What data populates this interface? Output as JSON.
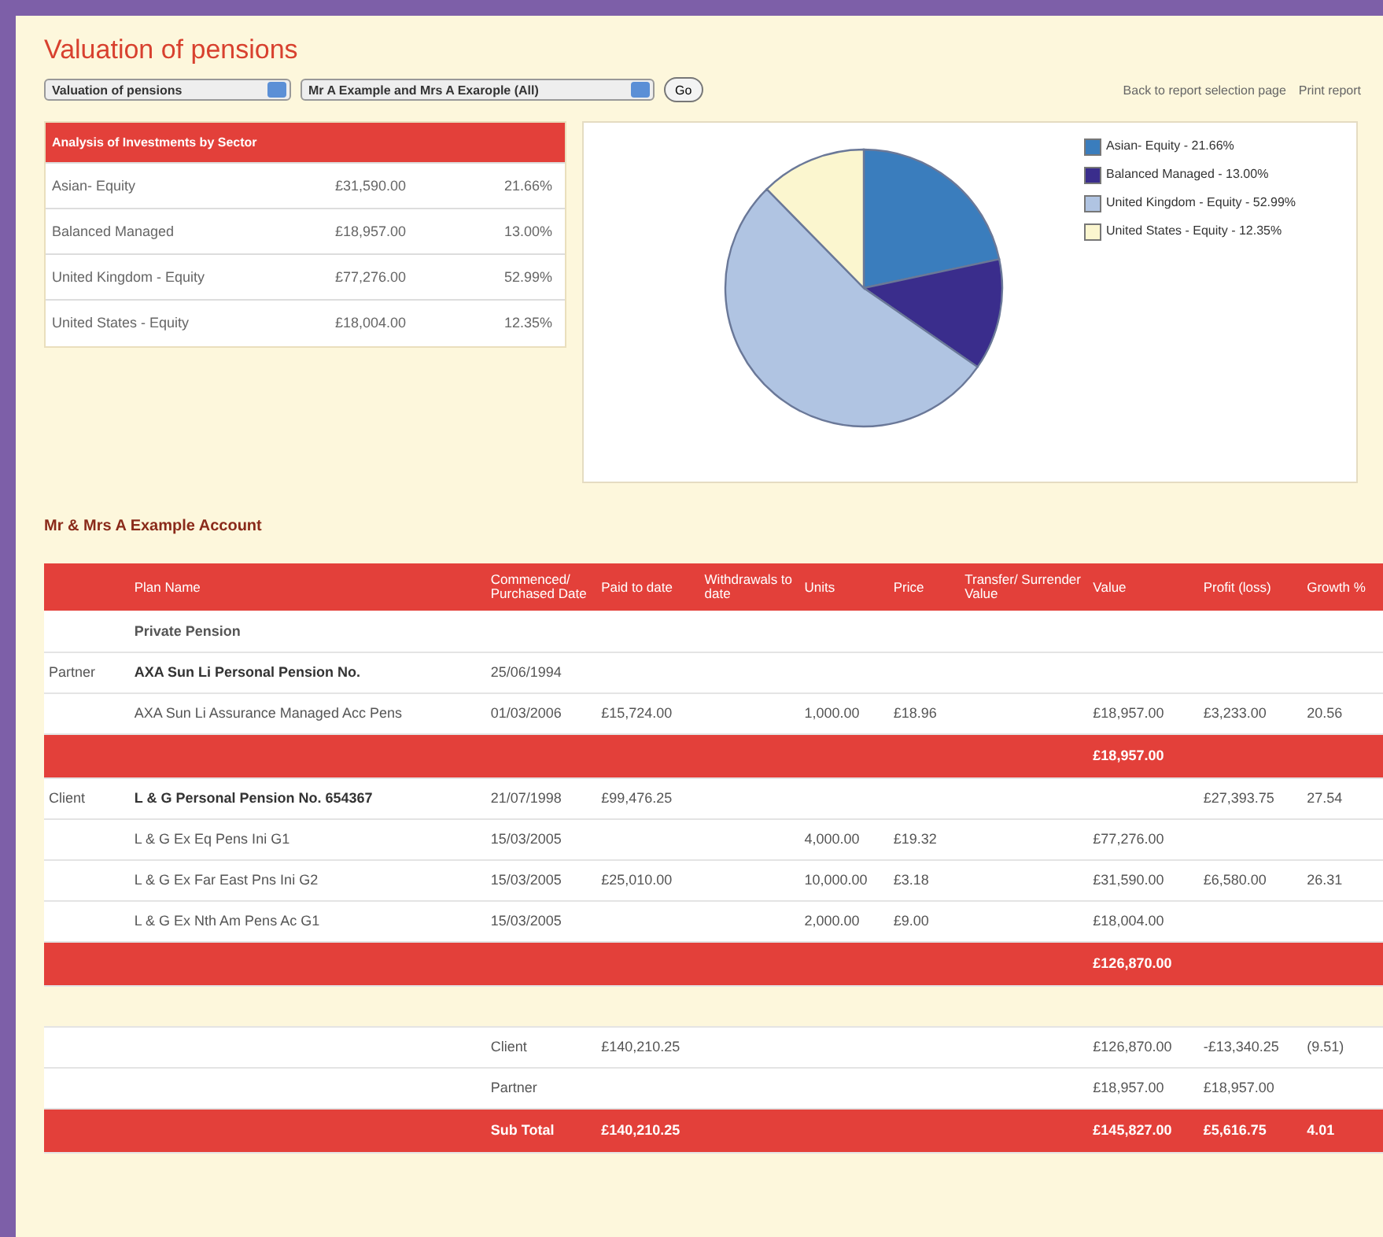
{
  "title": "Valuation of pensions",
  "report_select": {
    "value": "Valuation of pensions"
  },
  "client_select": {
    "value": "Mr A Example and Mrs A Exarople (All)"
  },
  "go_button": "Go",
  "links": [
    "Back to report selection page",
    "Print report"
  ],
  "sector_table": {
    "title": "Analysis of Investments by Sector",
    "rows": [
      {
        "sector": "Asian- Equity",
        "amount": "£31,590.00",
        "share": "21.66%"
      },
      {
        "sector": "Balanced Managed",
        "amount": "£18,957.00",
        "share": "13.00%"
      },
      {
        "sector": "United Kingdom - Equity",
        "amount": "£77,276.00",
        "share": "52.99%"
      },
      {
        "sector": "United States - Equity",
        "amount": "£18,004.00",
        "share": "12.35%"
      }
    ]
  },
  "chart": {
    "legend": [
      {
        "suffix": "- 21.66%",
        "color": "#3a7dbd"
      },
      {
        "suffix": "- 13.00%",
        "color": "#3a2d8c"
      },
      {
        "suffix": "- 52.99%",
        "color": "#b0c4e2"
      },
      {
        "suffix": "- 12.35%",
        "color": "#fbf6cf"
      }
    ],
    "chart_data": {
      "type": "pie",
      "categories": [
        "Asian- Equity",
        "Balanced Managed",
        "United Kingdom - Equity",
        "United States - Equity"
      ],
      "values": [
        21.66,
        13.0,
        52.99,
        12.35
      ]
    }
  },
  "account_title": "Mr & Mrs A Example Account",
  "table": {
    "columns": [
      null,
      "Plan Name",
      "Commenced/ Purchased Date",
      "Paid to date",
      "Withdrawals to date",
      "Units",
      "Price",
      "Transfer/ Surrender Value",
      "Value",
      "Profit (loss)",
      "Growth %"
    ],
    "rows": [
      {
        "kind": "section",
        "cells": [
          null,
          "Private Pension",
          null,
          null,
          null,
          null,
          null,
          null,
          null,
          null,
          null
        ]
      },
      {
        "kind": "plan",
        "cells": [
          "Partner",
          "AXA Sun Li Personal Pension No.",
          "25/06/1994",
          null,
          null,
          null,
          null,
          null,
          null,
          null,
          null
        ]
      },
      {
        "kind": "holding",
        "cells": [
          null,
          "AXA Sun Li Assurance Managed Acc Pens",
          "01/03/2006",
          "£15,724.00",
          null,
          "1,000.00",
          "£18.96",
          null,
          "£18,957.00",
          "£3,233.00",
          "20.56"
        ]
      },
      {
        "kind": "total",
        "cells": [
          null,
          null,
          null,
          null,
          null,
          null,
          null,
          null,
          "£18,957.00",
          null,
          null
        ]
      },
      {
        "kind": "plan",
        "cells": [
          "Client",
          "L & G Personal Pension No. 654367",
          "21/07/1998",
          "£99,476.25",
          null,
          null,
          null,
          null,
          null,
          "£27,393.75",
          "27.54"
        ]
      },
      {
        "kind": "holding",
        "cells": [
          null,
          "L & G Ex Eq Pens Ini G1",
          "15/03/2005",
          null,
          null,
          "4,000.00",
          "£19.32",
          null,
          "£77,276.00",
          null,
          null
        ]
      },
      {
        "kind": "holding",
        "cells": [
          null,
          "L & G Ex Far East Pns Ini G2",
          "15/03/2005",
          "£25,010.00",
          null,
          "10,000.00",
          "£3.18",
          null,
          "£31,590.00",
          "£6,580.00",
          "26.31"
        ]
      },
      {
        "kind": "holding",
        "cells": [
          null,
          "L & G Ex Nth Am Pens Ac G1",
          "15/03/2005",
          null,
          null,
          "2,000.00",
          "£9.00",
          null,
          "£18,004.00",
          null,
          null
        ]
      },
      {
        "kind": "total",
        "cells": [
          null,
          null,
          null,
          null,
          null,
          null,
          null,
          null,
          "£126,870.00",
          null,
          null
        ]
      },
      {
        "kind": "spacer",
        "cells": [
          null,
          null,
          null,
          null,
          null,
          null,
          null,
          null,
          null,
          null,
          null
        ]
      },
      {
        "kind": "summary",
        "cells": [
          null,
          null,
          "Client",
          "£140,210.25",
          null,
          null,
          null,
          null,
          "£126,870.00",
          "-£13,340.25",
          "(9.51)"
        ]
      },
      {
        "kind": "summary",
        "cells": [
          null,
          null,
          "Partner",
          null,
          null,
          null,
          null,
          null,
          "£18,957.00",
          "£18,957.00",
          null
        ]
      },
      {
        "kind": "total",
        "cells": [
          null,
          null,
          "Sub Total",
          "£140,210.25",
          null,
          null,
          null,
          null,
          "£145,827.00",
          "£5,616.75",
          "4.01"
        ]
      }
    ]
  }
}
